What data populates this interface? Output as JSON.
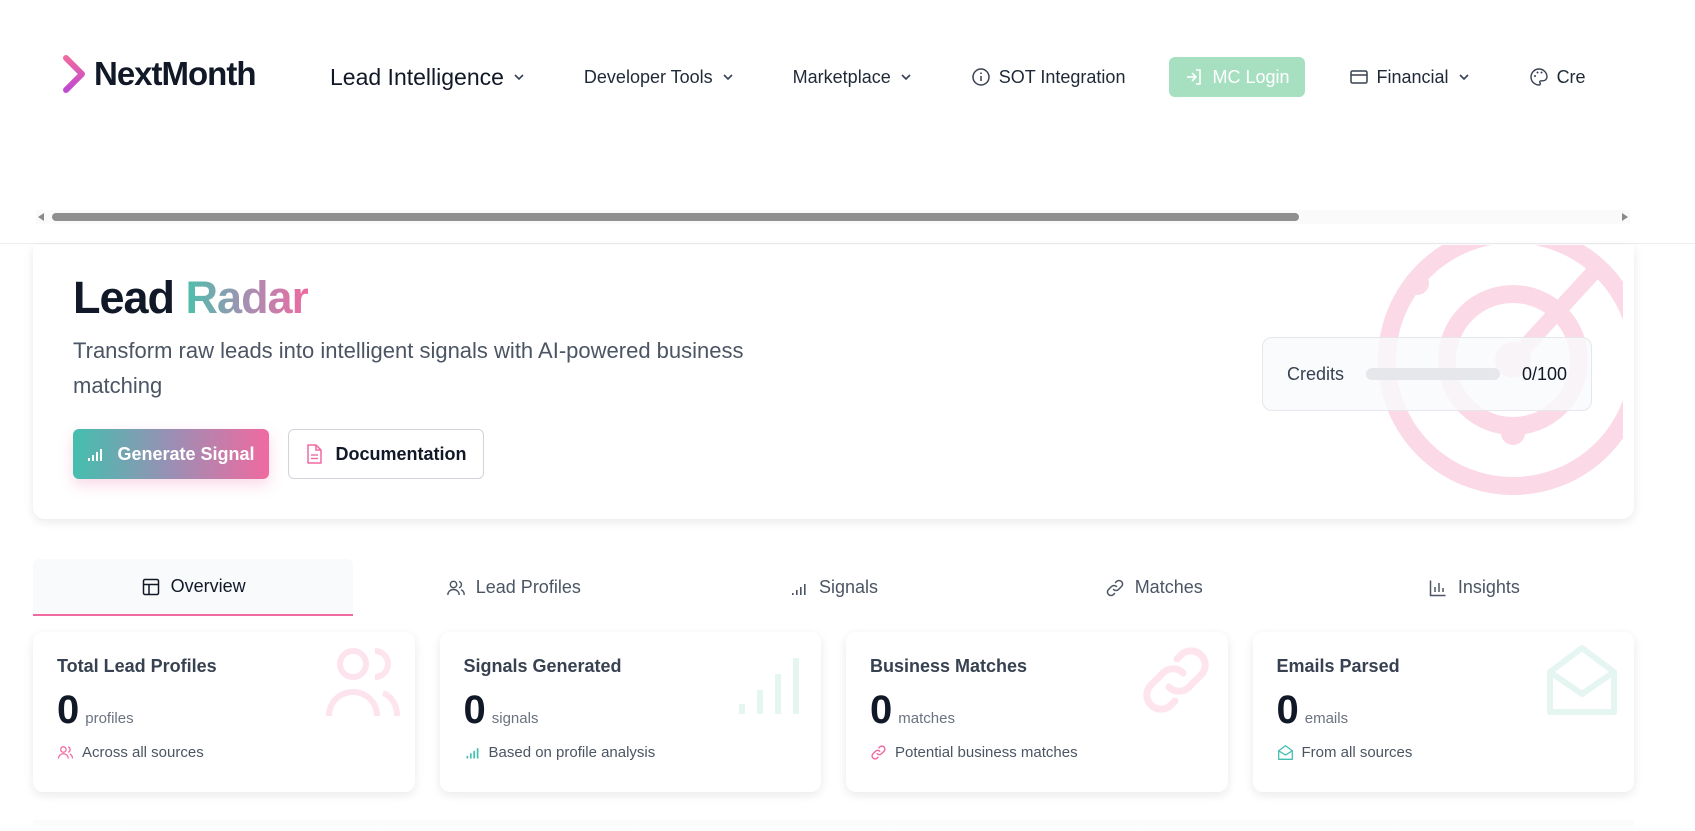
{
  "brand": {
    "name": "NextMonth"
  },
  "nav": {
    "items": [
      {
        "label": "Lead Intelligence",
        "has_dropdown": true
      },
      {
        "label": "Developer Tools",
        "has_dropdown": true
      },
      {
        "label": "Marketplace",
        "has_dropdown": true
      },
      {
        "label": "SOT Integration",
        "icon": "info-icon"
      },
      {
        "label": "MC Login",
        "icon": "login-icon"
      },
      {
        "label": "Financial",
        "icon": "credit-card-icon",
        "has_dropdown": true
      },
      {
        "label": "Cre",
        "icon": "palette-icon"
      }
    ]
  },
  "hero": {
    "title_part1": "Lead",
    "title_part2": "Radar",
    "subtitle": "Transform raw leads into intelligent signals with AI-powered business matching",
    "primary_button": "Generate Signal",
    "secondary_button": "Documentation",
    "credits": {
      "label": "Credits",
      "value": "0/100",
      "used_fraction": 0
    }
  },
  "tabs": [
    {
      "label": "Overview",
      "icon": "layout-icon",
      "active": true
    },
    {
      "label": "Lead Profiles",
      "icon": "users-icon",
      "active": false
    },
    {
      "label": "Signals",
      "icon": "signal-icon",
      "active": false
    },
    {
      "label": "Matches",
      "icon": "link-icon",
      "active": false
    },
    {
      "label": "Insights",
      "icon": "bar-chart-icon",
      "active": false
    }
  ],
  "stats": [
    {
      "title": "Total Lead Profiles",
      "value": "0",
      "unit": "profiles",
      "footer": "Across all sources",
      "icon": "users-icon"
    },
    {
      "title": "Signals Generated",
      "value": "0",
      "unit": "signals",
      "footer": "Based on profile analysis",
      "icon": "signal-icon"
    },
    {
      "title": "Business Matches",
      "value": "0",
      "unit": "matches",
      "footer": "Potential business matches",
      "icon": "link-icon"
    },
    {
      "title": "Emails Parsed",
      "value": "0",
      "unit": "emails",
      "footer": "From all sources",
      "icon": "mail-icon"
    }
  ],
  "colors": {
    "accent_pink": "#ef6aa1",
    "accent_teal": "#43bfae",
    "mc_login_bg": "#a7dfc1"
  }
}
